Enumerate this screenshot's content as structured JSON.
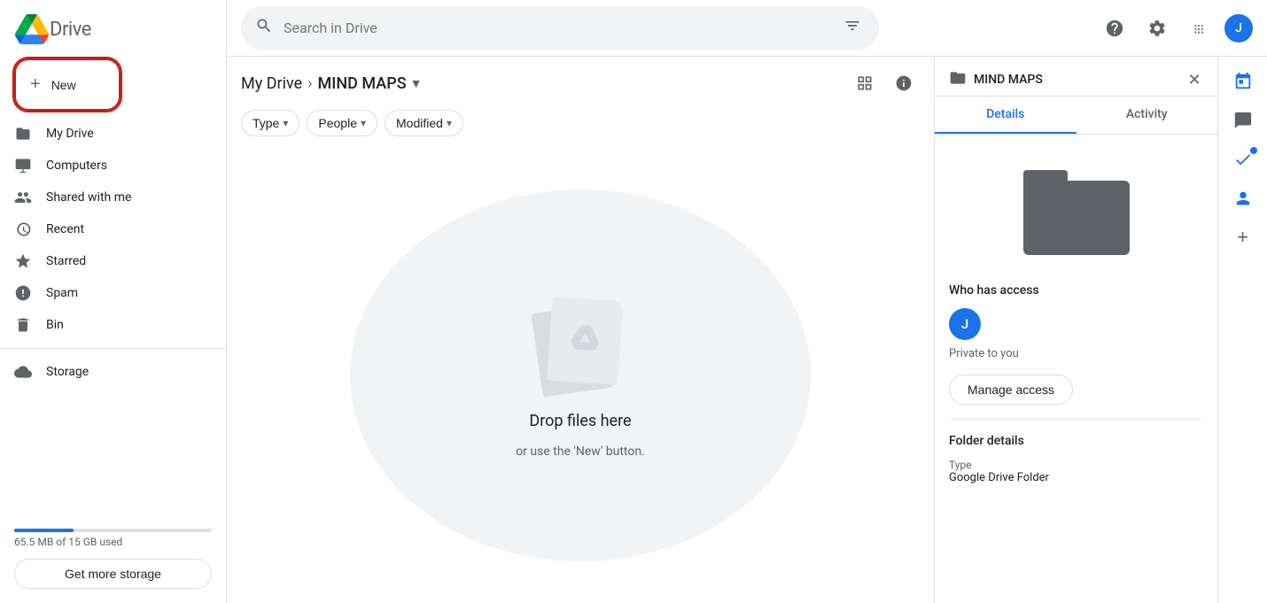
{
  "app": {
    "name": "Drive",
    "logo_alt": "Google Drive"
  },
  "sidebar": {
    "new_button_label": "New",
    "nav_items": [
      {
        "id": "my-drive",
        "label": "My Drive",
        "icon": "folder",
        "active": false
      },
      {
        "id": "computers",
        "label": "Computers",
        "icon": "computer",
        "active": false
      },
      {
        "id": "shared-with-me",
        "label": "Shared with me",
        "icon": "people",
        "active": false
      },
      {
        "id": "recent",
        "label": "Recent",
        "icon": "clock",
        "active": false
      },
      {
        "id": "starred",
        "label": "Starred",
        "icon": "star",
        "active": false
      },
      {
        "id": "spam",
        "label": "Spam",
        "icon": "warning",
        "active": false
      },
      {
        "id": "bin",
        "label": "Bin",
        "icon": "trash",
        "active": false
      },
      {
        "id": "storage",
        "label": "Storage",
        "icon": "cloud",
        "active": false
      }
    ],
    "storage": {
      "used_text": "65.5 MB of 15 GB used",
      "get_storage_label": "Get more storage",
      "percent": 30
    }
  },
  "header": {
    "search_placeholder": "Search in Drive"
  },
  "breadcrumb": {
    "parent": "My Drive",
    "current": "MIND MAPS"
  },
  "filters": [
    {
      "id": "type",
      "label": "Type"
    },
    {
      "id": "people",
      "label": "People"
    },
    {
      "id": "modified",
      "label": "Modified"
    }
  ],
  "drop_zone": {
    "title": "Drop files here",
    "subtitle": "or use the 'New' button."
  },
  "details_panel": {
    "folder_name": "MIND MAPS",
    "tabs": [
      {
        "id": "details",
        "label": "Details",
        "active": true
      },
      {
        "id": "activity",
        "label": "Activity",
        "active": false
      }
    ],
    "who_has_access_label": "Who has access",
    "user_initial": "J",
    "private_text": "Private to you",
    "manage_access_label": "Manage access",
    "folder_details_label": "Folder details",
    "type_label": "Type",
    "type_value": "Google Drive Folder"
  }
}
